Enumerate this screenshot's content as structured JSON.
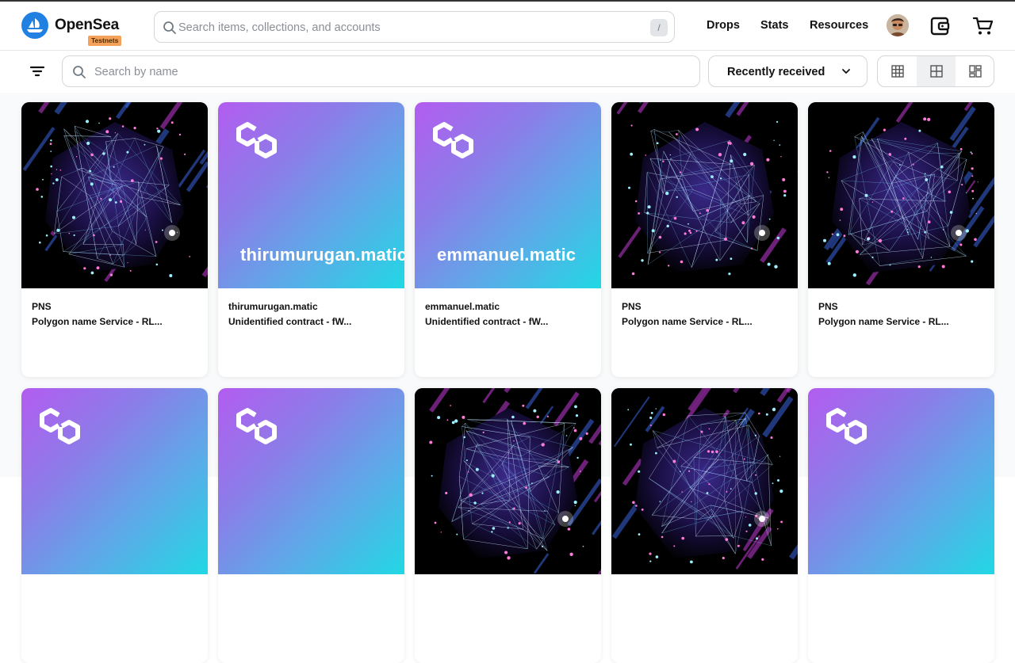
{
  "header": {
    "brand": "OpenSea",
    "badge": "Testnets",
    "search_placeholder": "Search items, collections, and accounts",
    "search_shortcut": "/",
    "nav": [
      "Drops",
      "Stats",
      "Resources"
    ]
  },
  "toolbar": {
    "search_placeholder": "Search by name",
    "sort_label": "Recently received"
  },
  "cards": [
    {
      "type": "art",
      "title": "",
      "collection": "PNS",
      "name": "Polygon name Service - RL..."
    },
    {
      "type": "poly",
      "title": "thirumurugan.matic",
      "collection": "thirumurugan.matic",
      "name": "Unidentified contract - fW..."
    },
    {
      "type": "poly",
      "title": "emmanuel.matic",
      "collection": "emmanuel.matic",
      "name": "Unidentified contract - fW..."
    },
    {
      "type": "art",
      "title": "",
      "collection": "PNS",
      "name": "Polygon name Service - RL..."
    },
    {
      "type": "art",
      "title": "",
      "collection": "PNS",
      "name": "Polygon name Service - RL..."
    },
    {
      "type": "poly",
      "title": "",
      "collection": "",
      "name": ""
    },
    {
      "type": "poly",
      "title": "",
      "collection": "",
      "name": ""
    },
    {
      "type": "art",
      "title": "",
      "collection": "",
      "name": ""
    },
    {
      "type": "art",
      "title": "",
      "collection": "",
      "name": ""
    },
    {
      "type": "poly",
      "title": "",
      "collection": "",
      "name": ""
    }
  ],
  "colors": {
    "accent": "#2081e2",
    "badge": "#f4a259"
  }
}
